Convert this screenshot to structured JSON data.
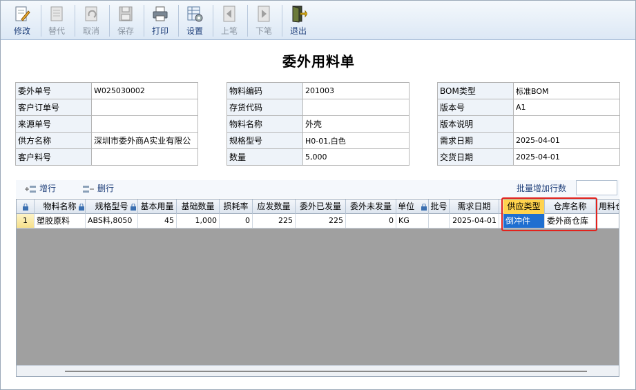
{
  "toolbar": {
    "buttons": [
      {
        "label": "修改",
        "icon": "edit-icon",
        "enabled": true
      },
      {
        "label": "替代",
        "icon": "document-icon",
        "enabled": false
      },
      {
        "label": "取消",
        "icon": "undo-icon",
        "enabled": false
      },
      {
        "label": "保存",
        "icon": "save-icon",
        "enabled": false
      },
      {
        "label": "打印",
        "icon": "printer-icon",
        "enabled": true
      },
      {
        "label": "设置",
        "icon": "settings-icon",
        "enabled": true
      },
      {
        "label": "上笔",
        "icon": "previous-icon",
        "enabled": false
      },
      {
        "label": "下笔",
        "icon": "next-icon",
        "enabled": false
      },
      {
        "label": "退出",
        "icon": "exit-icon",
        "enabled": true
      }
    ]
  },
  "form_title": "委外用料单",
  "left_fields": [
    {
      "label": "委外单号",
      "value": "W025030002"
    },
    {
      "label": "客户订单号",
      "value": ""
    },
    {
      "label": "来源单号",
      "value": ""
    },
    {
      "label": "供方名称",
      "value": "深圳市委外商A实业有限公"
    },
    {
      "label": "客户料号",
      "value": ""
    }
  ],
  "middle_fields": [
    {
      "label": "物料编码",
      "value": "201003"
    },
    {
      "label": "存货代码",
      "value": ""
    },
    {
      "label": "物料名称",
      "value": "外壳"
    },
    {
      "label": "规格型号",
      "value": "H0-01,白色"
    },
    {
      "label": "数量",
      "value": "5,000"
    }
  ],
  "right_fields": [
    {
      "label": "BOM类型",
      "value": "标准BOM"
    },
    {
      "label": "版本号",
      "value": "A1"
    },
    {
      "label": "版本说明",
      "value": ""
    },
    {
      "label": "需求日期",
      "value": "2025-04-01"
    },
    {
      "label": "交货日期",
      "value": "2025-04-01"
    }
  ],
  "row_toolbar": {
    "add_row": "增行",
    "delete_row": "删行",
    "batch_add_label": "批量增加行数",
    "batch_add_value": ""
  },
  "grid": {
    "columns": [
      "物料名称",
      "规格型号",
      "基本用量",
      "基础数量",
      "损耗率",
      "应发数量",
      "委外已发量",
      "委外未发量",
      "单位",
      "批号",
      "需求日期",
      "供应类型",
      "仓库名称",
      "用料仓"
    ],
    "rows": [
      {
        "row_no": "1",
        "cells": [
          "塑胶原料",
          "ABS料,8050",
          "45",
          "1,000",
          "0",
          "225",
          "225",
          "0",
          "KG",
          "",
          "2025-04-01",
          "倒冲件",
          "委外商仓库",
          ""
        ]
      }
    ]
  },
  "colors": {
    "highlight_header": "#ffd34d",
    "selected_cell": "#1f6fd0",
    "annotation_box": "#e3221c"
  }
}
